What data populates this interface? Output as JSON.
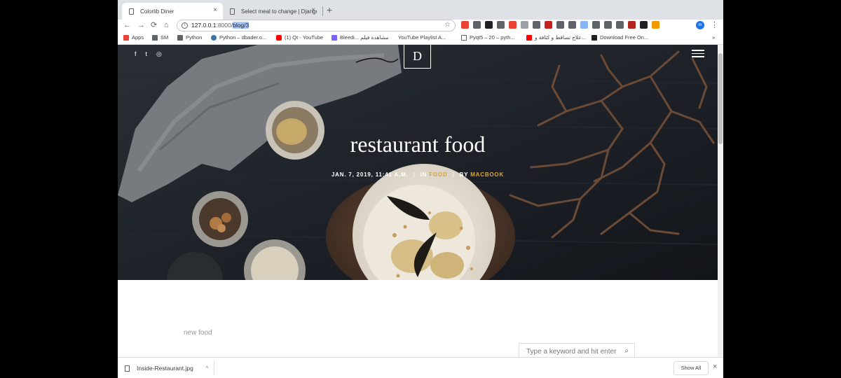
{
  "tabs": [
    {
      "title": "Colorlib Diner",
      "close": "×"
    },
    {
      "title": "Select meal to change | Django",
      "close": "×"
    }
  ],
  "toolbar": {
    "back": "←",
    "forward": "→",
    "reload": "⟳",
    "home": "⌂",
    "url_host": "127.0.0.1",
    "url_port": ":8000/",
    "url_path_selected": "blog/3",
    "star": "☆",
    "profile": "m",
    "menu": "⋮",
    "extension_colors": [
      "#ea4335",
      "#5f6368",
      "#202124",
      "#5f6368",
      "#ea4335",
      "#9aa0a6",
      "#5f6368",
      "#c5221f",
      "#5f6368",
      "#5f6368",
      "#8ab4f8",
      "#5f6368",
      "#5f6368",
      "#5f6368",
      "#b3261e",
      "#202124",
      "#f29900"
    ]
  },
  "bookmarks": [
    {
      "label": "Apps",
      "icon": "apps-icon",
      "color": "#ea4335"
    },
    {
      "label": "SM",
      "icon": "folder-icon",
      "color": "#5f6368"
    },
    {
      "label": "Python",
      "icon": "folder-icon",
      "color": "#5f6368"
    },
    {
      "label": "Python – dbader.o...",
      "icon": "python-icon",
      "color": "#3776ab"
    },
    {
      "label": "(1) Qt - YouTube",
      "icon": "youtube-icon",
      "color": "#ff0000"
    },
    {
      "label": "Bleedi... مشاهدة فيلم",
      "icon": "site-icon",
      "color": "#7b61ff"
    },
    {
      "label": "YouTube Playlist A...",
      "icon": "page-icon",
      "color": "#ffffff"
    },
    {
      "label": "Pyqt5 – 20 – pyth...",
      "icon": "page-icon",
      "color": "#ffffff"
    },
    {
      "label": "علاج تساقط و كثافة و...",
      "icon": "youtube-icon",
      "color": "#ff0000"
    },
    {
      "label": "Download Free On...",
      "icon": "site-icon",
      "color": "#202124"
    },
    {
      "label": "»",
      "icon": "more-bookmarks-icon",
      "color": "#5f6368"
    }
  ],
  "hero": {
    "social": [
      "f",
      "t",
      "◎"
    ],
    "logo": "D",
    "title": "restaurant food",
    "date": "JAN. 7, 2019, 11:41 A.M.",
    "in_label": "IN",
    "category": "FOOD",
    "by_label": "BY",
    "author": "MACBOOK",
    "sep": "|"
  },
  "content": {
    "body": "new food",
    "search_placeholder": "Type a keyword and hit enter",
    "search_icon": "⌕"
  },
  "downloads": {
    "file": "Inside-Restaurant.jpg",
    "caret": "^",
    "show_all": "Show All",
    "close": "×"
  }
}
